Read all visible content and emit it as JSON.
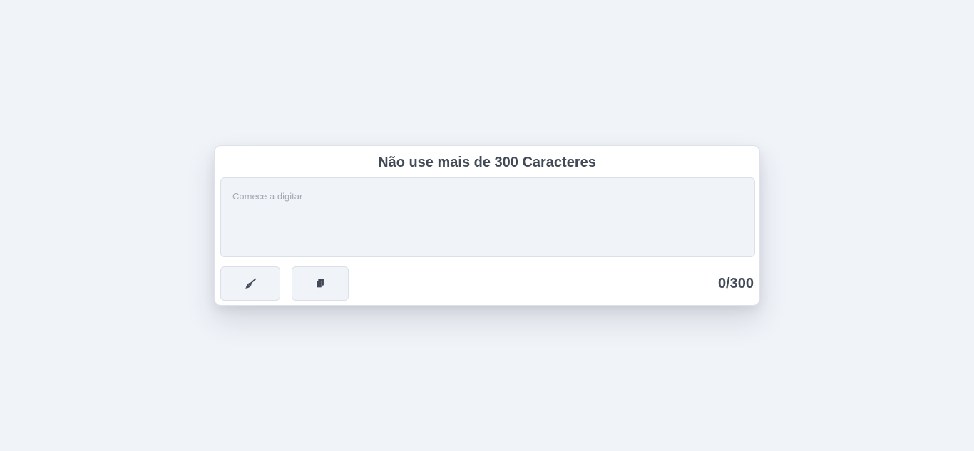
{
  "card": {
    "title": "Não use mais de 300 Caracteres"
  },
  "editor": {
    "value": "",
    "placeholder": "Comece a digitar"
  },
  "actions": {
    "clear_icon": "broom-icon",
    "copy_icon": "copy-icon"
  },
  "counter": {
    "text": "0/300",
    "current": 0,
    "max": 300
  },
  "colors": {
    "background": "#f0f3f8",
    "card": "#ffffff",
    "text": "#424a57",
    "placeholder": "#a3a9b3",
    "border": "#dbe0e8"
  }
}
